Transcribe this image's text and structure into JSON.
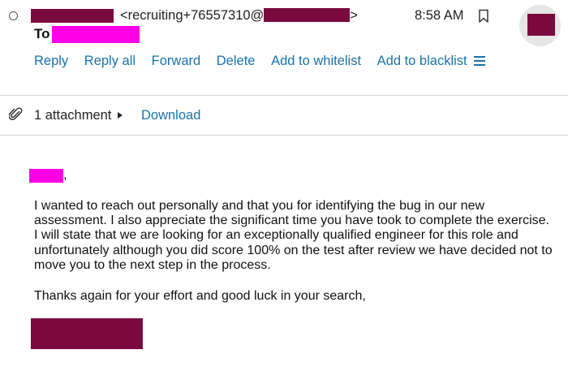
{
  "header": {
    "from_address": "<recruiting+76557310@",
    "from_address_end": ">",
    "time": "8:58 AM",
    "to_label": "To"
  },
  "actions": [
    {
      "label": "Reply"
    },
    {
      "label": "Reply all"
    },
    {
      "label": "Forward"
    },
    {
      "label": "Delete"
    },
    {
      "label": "Add to whitelist"
    },
    {
      "label": "Add to blacklist"
    }
  ],
  "attachments": {
    "count_label": "1 attachment",
    "download_label": "Download"
  },
  "body": {
    "salutation_punct": ",",
    "paragraph1": "I wanted to reach out personally and that you for identifying the bug in our new assessment. I also appreciate the significant time you have took to complete the exercise. I will state that we are looking for an exceptionally qualified engineer for this role and unfortunately although you did score 100% on the test after review we have decided not to move you to the next step in the process.",
    "paragraph2": "Thanks again for your effort and good luck in your search,"
  },
  "colors": {
    "link": "#1a73a8",
    "redaction_dark": "#7a0a3e",
    "redaction_pink": "#ff00e6"
  },
  "icons": [
    "radio-select-icon",
    "bookmark-icon",
    "menu-icon",
    "paperclip-icon",
    "caret-right-icon"
  ]
}
